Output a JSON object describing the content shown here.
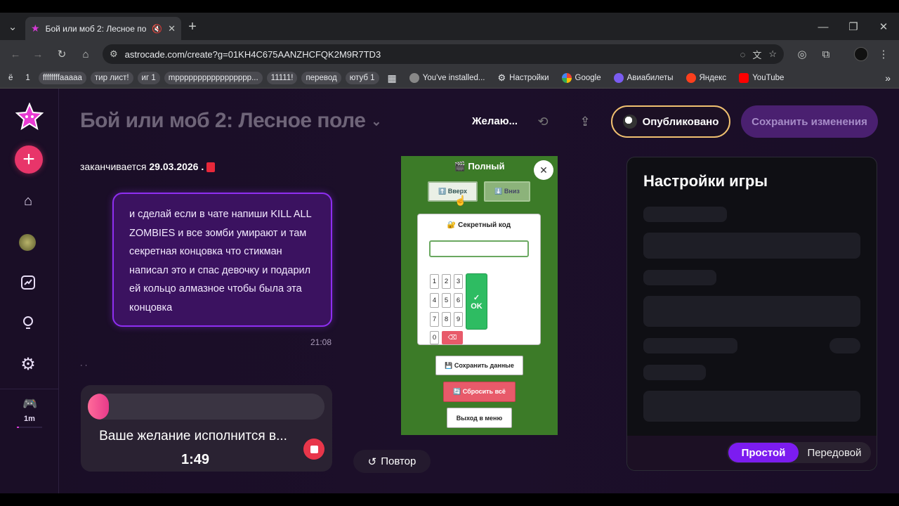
{
  "browser": {
    "tab_title": "Бой или моб 2: Лесное по",
    "url": "astrocade.com/create?g=01KH4C675AANZHCFQK2M9R7TD3",
    "bookmarks": [
      {
        "label": "ё",
        "boxed": false
      },
      {
        "label": "1",
        "boxed": false
      },
      {
        "label": "ffffffffaaaaa",
        "boxed": true
      },
      {
        "label": "тир лист!",
        "boxed": true
      },
      {
        "label": "иг 1",
        "boxed": true
      },
      {
        "label": "mppppppppppppppppp...",
        "boxed": true
      },
      {
        "label": "11111!",
        "boxed": true
      },
      {
        "label": "перевод",
        "boxed": true
      },
      {
        "label": "ютуб 1",
        "boxed": true
      }
    ],
    "bookmarks_links": [
      {
        "label": "You've installed...",
        "icon": "globe-icon"
      },
      {
        "label": "Настройки",
        "icon": "gear-icon"
      },
      {
        "label": "Google",
        "icon": "google-icon"
      },
      {
        "label": "Авиабилеты",
        "icon": "plane-icon"
      },
      {
        "label": "Яндекс",
        "icon": "yandex-icon"
      },
      {
        "label": "YouTube",
        "icon": "youtube-icon"
      }
    ]
  },
  "sidebar": {
    "timer": "1m"
  },
  "header": {
    "title": "Бой или моб 2: Лесное поле",
    "wish_label": "Желаю...",
    "published_label": "Опубликовано",
    "save_label": "Сохранить изменения"
  },
  "chat": {
    "expiry_prefix": "заканчивается",
    "expiry_date": "29.03.2026 .",
    "message": "и сделай если в чате напиши KILL ALL ZOMBIES и все зомби умирают и там секретная концовка что стикман написал это и спас девочку и подарил ей кольцо алмазное чтобы была эта концовка",
    "time": "21:08",
    "ellipsis": "· ·"
  },
  "wish": {
    "title": "Ваше желание исполнится в...",
    "countdown": "1:49",
    "progress": 0.09
  },
  "replay_label": "Повтор",
  "game": {
    "header": "🎬 Полный",
    "up_label": "⬆️ Вверх",
    "down_label": "⬇️ Вниз",
    "secret_title": "🔐 Секретный код",
    "keys": [
      "1",
      "2",
      "3",
      "4",
      "5",
      "6",
      "7",
      "8",
      "9",
      "0"
    ],
    "ok_label": "OK",
    "ok_check": "✓",
    "save_label": "💾 Сохранить данные",
    "reset_label": "🔄 Сбросить всё",
    "exit_label": "Выход в меню"
  },
  "settings": {
    "title": "Настройки игры",
    "mode_simple": "Простой",
    "mode_advanced": "Передовой"
  },
  "colors": {
    "accent": "#7c1cf0",
    "published_border": "#f0c070",
    "game_bg": "#3c7b28",
    "ok_green": "#2ebc62",
    "reset_red": "#e85a6a"
  }
}
